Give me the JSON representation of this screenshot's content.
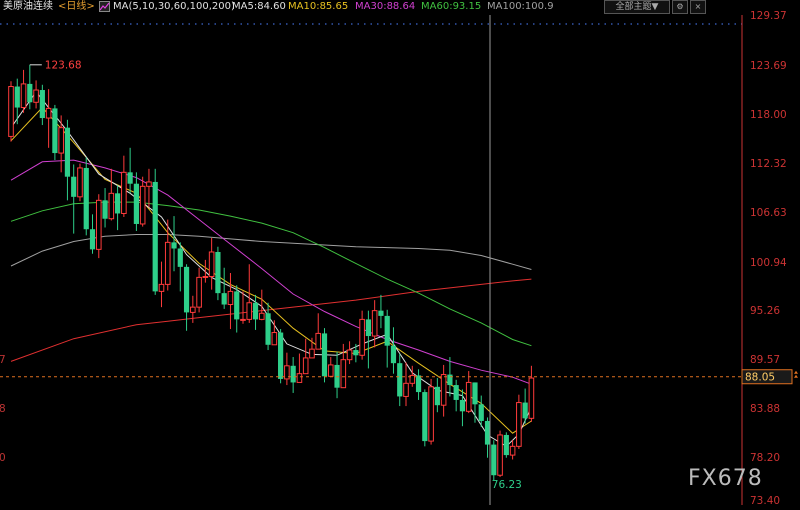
{
  "header": {
    "symbol": "美原油连续",
    "period": "<日线>",
    "ma_icon": "ma-indicator-icon",
    "ma_params": "MA(5,10,30,60,100,200)",
    "ma5": "MA5:84.60",
    "ma10": "MA10:85.65",
    "ma30": "MA30:88.64",
    "ma60": "MA60:93.15",
    "ma100": "MA100:100.9",
    "theme_button": "全部主题▼",
    "colors": {
      "symbol": "#e8e8e8",
      "period": "#e8a030",
      "params": "#e0e0e0",
      "ma5": "#e0e0e0",
      "ma10": "#e6c020",
      "ma30": "#d040d0",
      "ma60": "#40c040",
      "ma100": "#a0a0a0"
    }
  },
  "watermark": "FX678",
  "chart_data": {
    "type": "candlestick",
    "y_axis": {
      "ticks": [
        "129.37",
        "123.69",
        "118.00",
        "112.32",
        "106.63",
        "100.94",
        "95.26",
        "89.57",
        "83.88",
        "78.20",
        "73.40"
      ],
      "range": [
        73.4,
        129.37
      ],
      "current_price": "88.05",
      "current_price_value": 88.05,
      "left_partial_labels": [
        "7",
        "8",
        "0"
      ]
    },
    "annotations": {
      "high_label": "123.68",
      "high_value": 123.68,
      "low_label": "76.23",
      "low_value": 76.23
    },
    "colors": {
      "up": "#ff3b3b",
      "down": "#2ecf8a",
      "ma5": "#e0e0e0",
      "ma10": "#e6c020",
      "ma30": "#d040d0",
      "ma60": "#40c040",
      "ma100": "#a0a0a0",
      "ma200": "#e03030",
      "price_line": "#e07020",
      "crosshair": "#9a9a9a"
    },
    "candles": [
      [
        115.5,
        121.2,
        121.8,
        114.9
      ],
      [
        121.2,
        118.8,
        122.1,
        116.9
      ],
      [
        118.8,
        121.5,
        123.1,
        118.2
      ],
      [
        121.5,
        119.4,
        123.68,
        118.6
      ],
      [
        119.4,
        120.8,
        121.9,
        118.7
      ],
      [
        120.8,
        117.6,
        121.4,
        116.8
      ],
      [
        117.6,
        118.7,
        120.9,
        114.2
      ],
      [
        118.7,
        113.6,
        119.1,
        112.8
      ],
      [
        113.6,
        116.5,
        117.9,
        111.4
      ],
      [
        116.5,
        110.9,
        117.4,
        108.2
      ],
      [
        110.9,
        108.6,
        112.3,
        104.4
      ],
      [
        108.6,
        111.9,
        112.4,
        108.1
      ],
      [
        111.9,
        104.9,
        113.1,
        104.2
      ],
      [
        104.9,
        102.6,
        106.6,
        102.1
      ],
      [
        102.6,
        108.2,
        108.9,
        101.6
      ],
      [
        108.2,
        106.1,
        109.6,
        105.1
      ],
      [
        106.1,
        109.0,
        111.8,
        105.9
      ],
      [
        109.0,
        106.7,
        109.9,
        104.8
      ],
      [
        106.7,
        111.4,
        113.3,
        106.3
      ],
      [
        111.4,
        110.1,
        114.2,
        109.0
      ],
      [
        110.1,
        105.5,
        111.4,
        104.7
      ],
      [
        105.5,
        109.8,
        110.9,
        105.2
      ],
      [
        109.8,
        110.3,
        111.8,
        107.4
      ],
      [
        110.3,
        97.8,
        111.8,
        97.4
      ],
      [
        97.8,
        98.6,
        101.2,
        96.0
      ],
      [
        98.6,
        103.4,
        106.0,
        97.9
      ],
      [
        103.4,
        102.7,
        106.4,
        100.1
      ],
      [
        102.7,
        100.6,
        103.4,
        97.8
      ],
      [
        100.6,
        95.4,
        100.9,
        93.3
      ],
      [
        95.4,
        96.0,
        97.3,
        94.2
      ],
      [
        96.0,
        99.4,
        100.5,
        95.4
      ],
      [
        99.4,
        99.5,
        101.4,
        98.8
      ],
      [
        99.5,
        102.3,
        103.9,
        98.0
      ],
      [
        102.3,
        97.6,
        102.9,
        96.8
      ],
      [
        97.6,
        96.3,
        100.5,
        95.8
      ],
      [
        96.3,
        97.8,
        99.9,
        93.5
      ],
      [
        97.8,
        94.6,
        98.5,
        93.1
      ],
      [
        94.6,
        94.6,
        97.8,
        94.1
      ],
      [
        94.6,
        96.5,
        100.9,
        94.2
      ],
      [
        96.5,
        94.6,
        97.4,
        93.4
      ],
      [
        94.6,
        95.3,
        98.0,
        94.5
      ],
      [
        95.3,
        91.7,
        96.5,
        91.1
      ],
      [
        91.7,
        93.1,
        94.5,
        92.4
      ],
      [
        93.1,
        87.8,
        93.5,
        87.3
      ],
      [
        87.8,
        89.3,
        90.8,
        87.1
      ],
      [
        89.3,
        87.4,
        90.3,
        86.2
      ],
      [
        87.4,
        88.4,
        90.7,
        87.9
      ],
      [
        88.4,
        90.2,
        92.4,
        89.6
      ],
      [
        90.2,
        91.2,
        92.5,
        90.3
      ],
      [
        91.2,
        93.0,
        95.3,
        91.8
      ],
      [
        93.0,
        88.1,
        93.6,
        87.4
      ],
      [
        88.1,
        89.4,
        90.3,
        88.0
      ],
      [
        89.4,
        86.8,
        90.9,
        85.6
      ],
      [
        86.8,
        90.0,
        91.8,
        88.2
      ],
      [
        90.0,
        91.1,
        92.1,
        89.5
      ],
      [
        91.1,
        90.5,
        91.8,
        89.7
      ],
      [
        90.5,
        94.6,
        95.6,
        90.0
      ],
      [
        94.6,
        92.7,
        95.6,
        89.0
      ],
      [
        92.7,
        95.6,
        96.8,
        91.4
      ],
      [
        95.6,
        95.0,
        97.4,
        93.6
      ],
      [
        95.0,
        91.6,
        95.7,
        89.1
      ],
      [
        91.6,
        89.6,
        93.7,
        88.4
      ],
      [
        89.6,
        85.8,
        90.7,
        84.7
      ],
      [
        85.8,
        87.3,
        89.7,
        84.7
      ],
      [
        87.3,
        88.2,
        89.3,
        86.9
      ],
      [
        88.2,
        86.3,
        88.9,
        85.4
      ],
      [
        86.3,
        80.7,
        86.6,
        80.1
      ],
      [
        80.7,
        86.9,
        87.8,
        80.3
      ],
      [
        86.9,
        84.8,
        87.9,
        84.0
      ],
      [
        84.8,
        88.3,
        89.4,
        83.5
      ],
      [
        88.3,
        87.1,
        90.3,
        85.8
      ],
      [
        87.1,
        85.4,
        87.7,
        84.1
      ],
      [
        85.4,
        84.1,
        86.6,
        82.4
      ],
      [
        84.1,
        87.4,
        88.7,
        83.9
      ],
      [
        87.4,
        84.9,
        87.4,
        82.8
      ],
      [
        84.9,
        83.0,
        85.9,
        82.3
      ],
      [
        83.0,
        80.3,
        83.4,
        78.8
      ],
      [
        80.3,
        76.8,
        80.8,
        76.23
      ],
      [
        76.8,
        81.4,
        81.9,
        76.6
      ],
      [
        81.4,
        79.1,
        81.7,
        78.8
      ],
      [
        79.1,
        80.1,
        80.8,
        78.6
      ],
      [
        80.1,
        85.1,
        86.0,
        79.8
      ],
      [
        85.1,
        83.3,
        86.7,
        82.7
      ],
      [
        83.3,
        87.9,
        89.3,
        82.9
      ]
    ],
    "ma": {
      "ma5": [
        [
          0,
          116.5
        ],
        [
          4,
          120.6
        ],
        [
          9,
          116.1
        ],
        [
          14,
          111.2
        ],
        [
          19,
          109.0
        ],
        [
          24,
          106.3
        ],
        [
          28,
          102.0
        ],
        [
          32,
          99.4
        ],
        [
          36,
          98.0
        ],
        [
          40,
          96.1
        ],
        [
          44,
          91.8
        ],
        [
          48,
          90.6
        ],
        [
          52,
          90.5
        ],
        [
          56,
          91.8
        ],
        [
          60,
          92.9
        ],
        [
          64,
          88.5
        ],
        [
          68,
          86.5
        ],
        [
          72,
          85.9
        ],
        [
          76,
          81.4
        ],
        [
          79,
          80.1
        ],
        [
          81,
          81.5
        ],
        [
          83,
          84.6
        ]
      ],
      "ma10": [
        [
          0,
          115.0
        ],
        [
          5,
          118.8
        ],
        [
          10,
          114.8
        ],
        [
          15,
          110.6
        ],
        [
          20,
          109.0
        ],
        [
          25,
          104.5
        ],
        [
          30,
          101.0
        ],
        [
          35,
          98.6
        ],
        [
          40,
          96.9
        ],
        [
          45,
          93.6
        ],
        [
          50,
          91.0
        ],
        [
          55,
          90.7
        ],
        [
          60,
          92.1
        ],
        [
          65,
          89.6
        ],
        [
          70,
          87.2
        ],
        [
          75,
          85.0
        ],
        [
          80,
          81.6
        ],
        [
          83,
          83.0
        ]
      ],
      "ma30": [
        [
          0,
          110.5
        ],
        [
          5,
          112.6
        ],
        [
          10,
          112.8
        ],
        [
          15,
          111.9
        ],
        [
          20,
          110.8
        ],
        [
          25,
          108.8
        ],
        [
          30,
          106.0
        ],
        [
          35,
          103.2
        ],
        [
          40,
          100.4
        ],
        [
          45,
          97.5
        ],
        [
          50,
          95.5
        ],
        [
          55,
          93.8
        ],
        [
          60,
          92.3
        ],
        [
          65,
          91.1
        ],
        [
          70,
          89.8
        ],
        [
          75,
          88.8
        ],
        [
          80,
          88.0
        ],
        [
          83,
          87.2
        ]
      ],
      "ma60": [
        [
          0,
          105.8
        ],
        [
          5,
          107.0
        ],
        [
          10,
          107.8
        ],
        [
          15,
          108.0
        ],
        [
          20,
          108.0
        ],
        [
          25,
          107.6
        ],
        [
          30,
          107.1
        ],
        [
          35,
          106.4
        ],
        [
          40,
          105.6
        ],
        [
          45,
          104.5
        ],
        [
          50,
          102.8
        ],
        [
          55,
          101.0
        ],
        [
          60,
          99.2
        ],
        [
          65,
          97.6
        ],
        [
          70,
          95.8
        ],
        [
          75,
          94.2
        ],
        [
          80,
          92.3
        ],
        [
          83,
          91.6
        ]
      ],
      "ma100": [
        [
          0,
          100.7
        ],
        [
          5,
          102.4
        ],
        [
          10,
          103.5
        ],
        [
          15,
          104.1
        ],
        [
          20,
          104.3
        ],
        [
          25,
          104.3
        ],
        [
          30,
          104.1
        ],
        [
          35,
          103.8
        ],
        [
          40,
          103.5
        ],
        [
          45,
          103.3
        ],
        [
          50,
          103.1
        ],
        [
          55,
          102.9
        ],
        [
          60,
          102.8
        ],
        [
          65,
          102.7
        ],
        [
          70,
          102.5
        ],
        [
          75,
          101.9
        ],
        [
          80,
          100.9
        ],
        [
          83,
          100.3
        ]
      ],
      "ma200": [
        [
          0,
          89.8
        ],
        [
          10,
          92.4
        ],
        [
          20,
          94.0
        ],
        [
          25,
          94.4
        ],
        [
          30,
          94.8
        ],
        [
          35,
          95.2
        ],
        [
          40,
          95.6
        ],
        [
          45,
          96.0
        ],
        [
          50,
          96.4
        ],
        [
          55,
          96.8
        ],
        [
          60,
          97.3
        ],
        [
          65,
          97.8
        ],
        [
          70,
          98.2
        ],
        [
          75,
          98.6
        ],
        [
          80,
          99.0
        ],
        [
          83,
          99.2
        ]
      ]
    }
  }
}
